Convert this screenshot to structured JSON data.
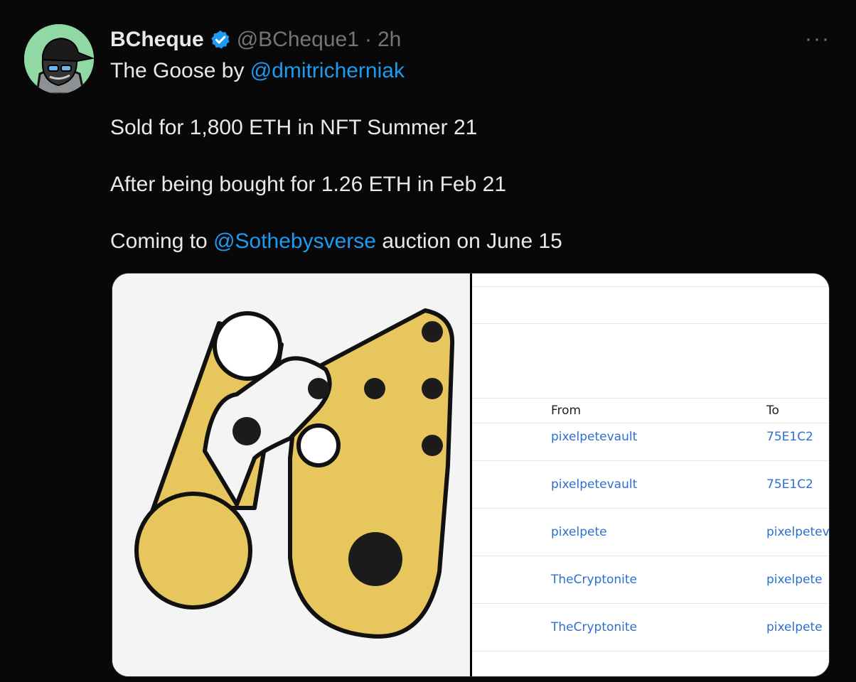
{
  "tweet": {
    "name": "BCheque",
    "handle": "@BCheque1",
    "separator": "·",
    "time": "2h",
    "more": "···",
    "line1_prefix": "The Goose by ",
    "line1_mention": "@dmitricherniak",
    "line2": "Sold for 1,800 ETH in NFT Summer 21",
    "line3": "After being bought for 1.26 ETH in Feb 21",
    "line4_prefix": "Coming to ",
    "line4_mention": "@Sothebysverse",
    "line4_suffix": " auction on June 15"
  },
  "transfers": {
    "headers": {
      "from": "From",
      "to": "To"
    },
    "rows": [
      {
        "from": "pixelpetevault",
        "to": "75E1C2"
      },
      {
        "from": "pixelpetevault",
        "to": "75E1C2"
      },
      {
        "from": "pixelpete",
        "to": "pixelpetev"
      },
      {
        "from": "TheCryptonite",
        "to": "pixelpete"
      },
      {
        "from": "TheCryptonite",
        "to": "pixelpete"
      }
    ]
  },
  "colors": {
    "background": "#080808",
    "text": "#e7e9ea",
    "secondary": "#71767b",
    "link": "#1d9bf0",
    "verified": "#1d9bf0",
    "art_yellow": "#e8c65e",
    "table_link": "#2c6fd1"
  },
  "icons": {
    "verified": "verified-badge-icon",
    "more": "more-dots-icon"
  }
}
